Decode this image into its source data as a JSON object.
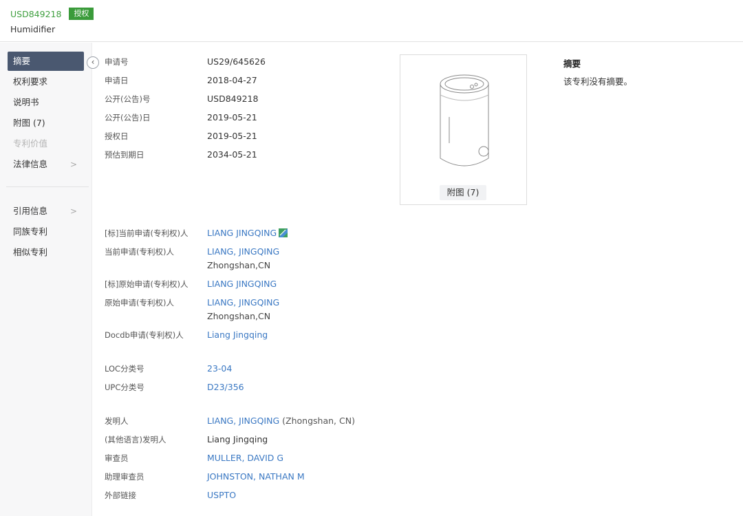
{
  "header": {
    "pub_number": "USD849218",
    "status": "授权",
    "title": "Humidifier"
  },
  "sidebar": {
    "items": [
      {
        "label": "摘要"
      },
      {
        "label": "权利要求"
      },
      {
        "label": "说明书"
      },
      {
        "label": "附图 (7)"
      },
      {
        "label": "专利价值"
      },
      {
        "label": "法律信息"
      },
      {
        "label": "引用信息"
      },
      {
        "label": "同族专利"
      },
      {
        "label": "相似专利"
      }
    ]
  },
  "basic": [
    {
      "label": "申请号",
      "value": "US29/645626"
    },
    {
      "label": "申请日",
      "value": "2018-04-27"
    },
    {
      "label": "公开(公告)号",
      "value": "USD849218"
    },
    {
      "label": "公开(公告)日",
      "value": "2019-05-21"
    },
    {
      "label": "授权日",
      "value": "2019-05-21"
    },
    {
      "label": "预估到期日",
      "value": "2034-05-21"
    }
  ],
  "applicants": [
    {
      "label": "[标]当前申请(专利权)人",
      "value": "LIANG JINGQING"
    },
    {
      "label": "当前申请(专利权)人",
      "value": "LIANG, JINGQING",
      "sub": "Zhongshan,CN"
    },
    {
      "label": "[标]原始申请(专利权)人",
      "value": "LIANG JINGQING"
    },
    {
      "label": "原始申请(专利权)人",
      "value": "LIANG, JINGQING",
      "sub": "Zhongshan,CN"
    },
    {
      "label": "Docdb申请(专利权)人",
      "value": "Liang Jingqing"
    }
  ],
  "classes": [
    {
      "label": "LOC分类号",
      "value": "23-04"
    },
    {
      "label": "UPC分类号",
      "value": "D23/356"
    }
  ],
  "people": [
    {
      "label": "发明人",
      "value": "LIANG, JINGQING",
      "suffix": "(Zhongshan, CN)"
    },
    {
      "label": "(其他语言)发明人",
      "value": "Liang Jingqing"
    },
    {
      "label": "审查员",
      "value": "MULLER, DAVID G"
    },
    {
      "label": "助理审查员",
      "value": "JOHNSTON, NATHAN M"
    },
    {
      "label": "外部链接",
      "value": "USPTO"
    }
  ],
  "figure": {
    "button_label": "附图 (7)"
  },
  "abstract": {
    "title": "摘要",
    "text": "该专利没有摘要。"
  },
  "colors": {
    "accent_green": "#3a9b3a",
    "link_blue": "#3a78c3",
    "nav_active": "#4a5870"
  },
  "icons": {
    "collapse": "chevron-left-icon",
    "nav_expand": "chevron-right-icon",
    "flag": "company-flag-icon"
  }
}
